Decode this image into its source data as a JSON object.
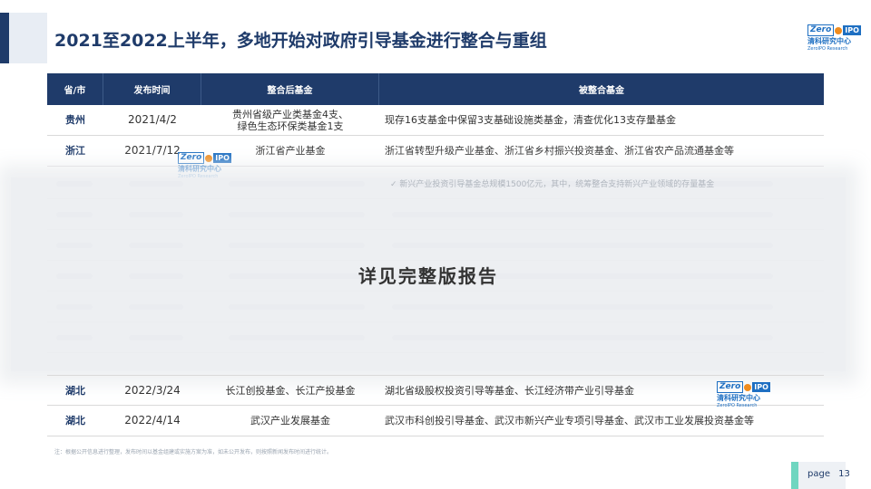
{
  "header": {
    "title": "2021至2022上半年，多地开始对政府引导基金进行整合与重组"
  },
  "logo": {
    "zero": "Zero",
    "ipo": "IPO",
    "cn": "清科研究中心",
    "en": "ZeroIPO Research"
  },
  "table": {
    "headers": [
      "省/市",
      "发布时间",
      "整合后基金",
      "被整合基金"
    ],
    "rows": [
      {
        "province": "贵州",
        "date": "2021/4/2",
        "merged_line1": "贵州省级产业类基金4支、",
        "merged_line2": "绿色生态环保类基金1支",
        "source": "现存16支基金中保留3支基础设施类基金，清查优化13支存量基金"
      },
      {
        "province": "浙江",
        "date": "2021/7/12",
        "merged_line1": "浙江省产业基金",
        "merged_line2": "",
        "source": "浙江省转型升级产业基金、浙江省乡村振兴投资基金、浙江省农产品流通基金等"
      },
      {
        "province": "湖北",
        "date": "2022/3/24",
        "merged_line1": "长江创投基金、长江产投基金",
        "merged_line2": "",
        "source": "湖北省级股权投资引导等基金、长江经济带产业引导基金"
      },
      {
        "province": "湖北",
        "date": "2022/4/14",
        "merged_line1": "武汉产业发展基金",
        "merged_line2": "",
        "source": "武汉市科创投引导基金、武汉市新兴产业专项引导基金、武汉市工业发展投资基金等"
      }
    ],
    "hidden_preview": "✓ 新兴产业投资引导基金总规模1500亿元，其中，统筹整合支持新兴产业领域的存量基金"
  },
  "overlay": {
    "text": "详见完整版报告"
  },
  "footer": {
    "note": "注：根据公开信息进行整理，发布时间以基金组建或实施方案为准，如未公开发布，则按照新闻发布时间进行统计。",
    "page_label": "page",
    "page_number": "13"
  }
}
